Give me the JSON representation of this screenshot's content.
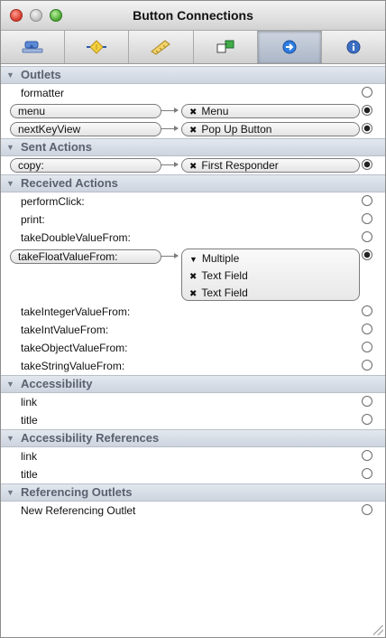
{
  "window": {
    "title": "Button Connections"
  },
  "toolbar": {
    "tabs": [
      {
        "icon": "attributes-icon",
        "selected": false
      },
      {
        "icon": "effects-icon",
        "selected": false
      },
      {
        "icon": "size-ruler-icon",
        "selected": false
      },
      {
        "icon": "bindings-icon",
        "selected": false
      },
      {
        "icon": "connections-arrow-icon",
        "selected": true
      },
      {
        "icon": "identity-info-icon",
        "selected": false
      }
    ]
  },
  "outlets": {
    "title": "Outlets",
    "formatter": "formatter",
    "menu": {
      "label": "menu",
      "target": "Menu"
    },
    "nextKeyView": {
      "label": "nextKeyView",
      "target": "Pop Up Button"
    }
  },
  "sent_actions": {
    "title": "Sent Actions",
    "copy": {
      "label": "copy:",
      "target": "First Responder"
    }
  },
  "received_actions": {
    "title": "Received Actions",
    "performClick": "performClick:",
    "print": "print:",
    "takeDoubleValueFrom": "takeDoubleValueFrom:",
    "takeFloatValueFrom": {
      "label": "takeFloatValueFrom:",
      "targets": [
        "Multiple",
        "Text Field",
        "Text Field"
      ]
    },
    "takeIntegerValueFrom": "takeIntegerValueFrom:",
    "takeIntValueFrom": "takeIntValueFrom:",
    "takeObjectValueFrom": "takeObjectValueFrom:",
    "takeStringValueFrom": "takeStringValueFrom:"
  },
  "accessibility": {
    "title": "Accessibility",
    "link": "link",
    "titleItem": "title"
  },
  "accessibility_references": {
    "title": "Accessibility References",
    "link": "link",
    "titleItem": "title"
  },
  "referencing_outlets": {
    "title": "Referencing Outlets",
    "new": "New Referencing Outlet"
  },
  "colors": {
    "section_header_text": "#5a6270",
    "selected_tab": "#aab5c6",
    "pill_border": "#7c7c7c"
  }
}
